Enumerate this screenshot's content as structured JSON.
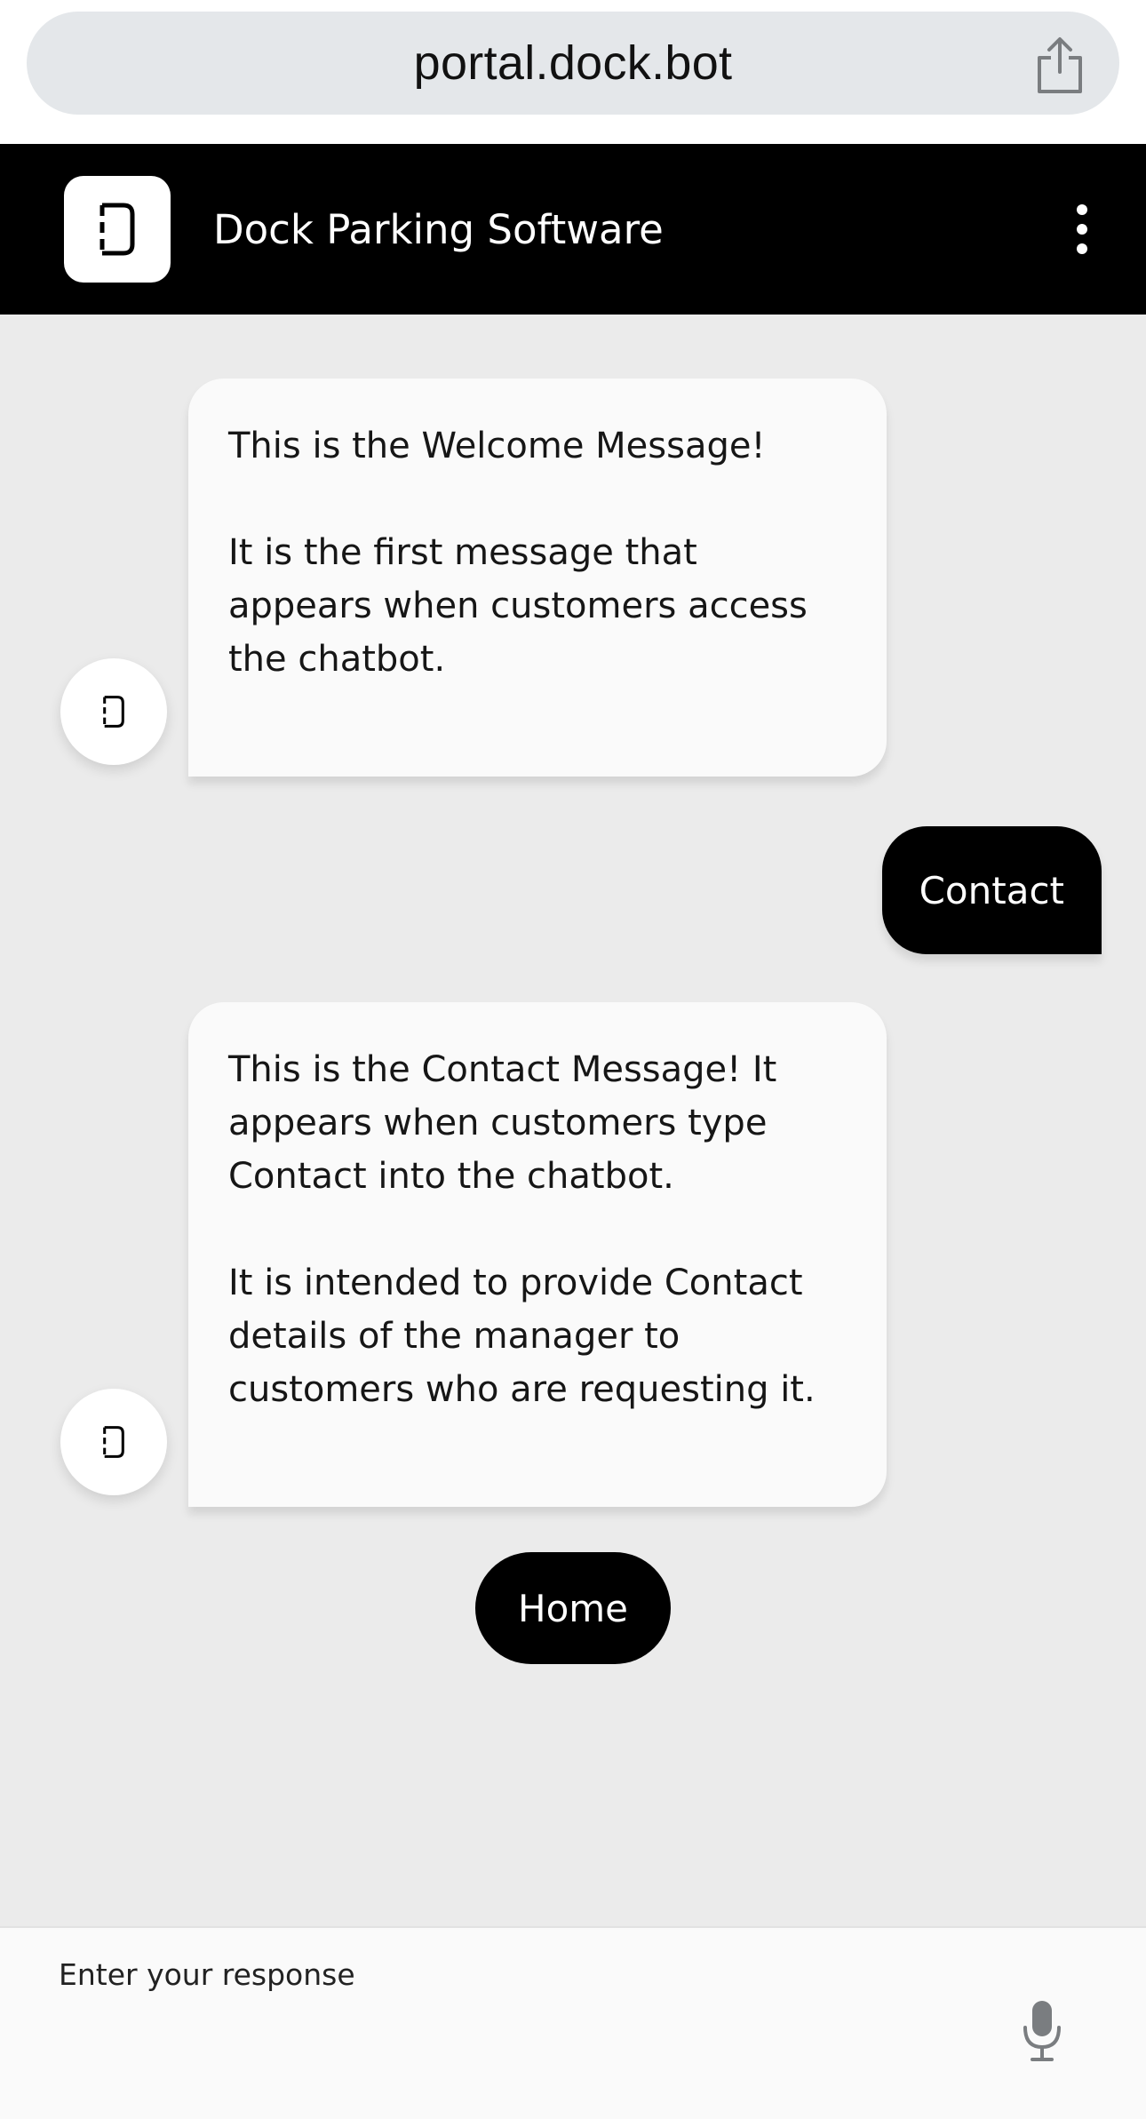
{
  "browser": {
    "url": "portal.dock.bot",
    "share_icon": "share-icon"
  },
  "header": {
    "title": "Dock Parking Software",
    "logo_icon": "dock-logo-icon",
    "menu_icon": "kebab-menu-icon",
    "background": "#000000"
  },
  "messages": [
    {
      "sender": "bot",
      "text": "This is the Welcome Message!\n\nIt is the first message that appears when customers access the chatbot."
    },
    {
      "sender": "user",
      "text": "Contact"
    },
    {
      "sender": "bot",
      "text": "This is the Contact Message! It appears when customers type Contact into the chatbot.\n\nIt is intended to provide Contact details of the manager to customers who are requesting it."
    }
  ],
  "quick_reply": {
    "label": "Home"
  },
  "input": {
    "placeholder": "Enter your response",
    "value": "",
    "mic_icon": "microphone-icon"
  },
  "colors": {
    "chat_background": "#ebebeb",
    "bot_bubble": "#fafafa",
    "user_bubble": "#000000",
    "url_bar": "#e4e7ea"
  }
}
